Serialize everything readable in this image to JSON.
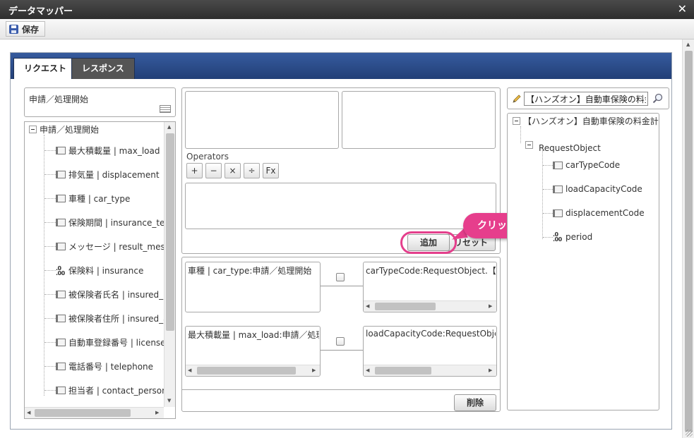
{
  "window": {
    "title": "データマッパー"
  },
  "toolbar": {
    "save_label": "保存"
  },
  "tabs": [
    {
      "label": "リクエスト",
      "active": true
    },
    {
      "label": "レスポンス",
      "active": false
    }
  ],
  "source": {
    "name": "申請／処理開始",
    "tree": {
      "root": "申請／処理開始",
      "items": [
        {
          "label": "最大積載量 | max_load",
          "icon": "field-icon"
        },
        {
          "label": "排気量 | displacement",
          "icon": "field-icon"
        },
        {
          "label": "車種 | car_type",
          "icon": "field-icon"
        },
        {
          "label": "保険期間 | insurance_terr",
          "icon": "field-icon"
        },
        {
          "label": "メッセージ | result_messag",
          "icon": "field-icon"
        },
        {
          "label": "保険料 | insurance",
          "icon": "number-icon"
        },
        {
          "label": "被保険者氏名 | insured_n",
          "icon": "field-icon"
        },
        {
          "label": "被保険者住所 | insured_a",
          "icon": "field-icon"
        },
        {
          "label": "自動車登録番号 | license_",
          "icon": "field-icon"
        },
        {
          "label": "電話番号 | telephone",
          "icon": "field-icon"
        },
        {
          "label": "担当者 | contact_personn",
          "icon": "field-icon"
        }
      ]
    }
  },
  "expression": {
    "operators_label": "Operators",
    "operators": [
      "+",
      "−",
      "×",
      "÷",
      "Fx"
    ],
    "add_label": "追加",
    "reset_label": "リセット",
    "callout_text": "クリック"
  },
  "mappings": [
    {
      "source": "車種 | car_type:申請／処理開始",
      "target": "carTypeCode:RequestObject.【ハン"
    },
    {
      "source": "最大積載量 | max_load:申請／処理開",
      "target": "loadCapacityCode:RequestObject"
    }
  ],
  "delete_label": "削除",
  "target": {
    "search_value": "【ハンズオン】自動車保険の料金計算",
    "tree": {
      "root": "【ハンズオン】自動車保険の料金計算",
      "object": "RequestObject",
      "items": [
        {
          "label": "carTypeCode",
          "icon": "field-icon"
        },
        {
          "label": "loadCapacityCode",
          "icon": "field-icon"
        },
        {
          "label": "displacementCode",
          "icon": "field-icon"
        },
        {
          "label": "period",
          "icon": "number-icon"
        }
      ]
    }
  },
  "colors": {
    "accent": "#2b4a88",
    "highlight": "#e63e8c"
  }
}
